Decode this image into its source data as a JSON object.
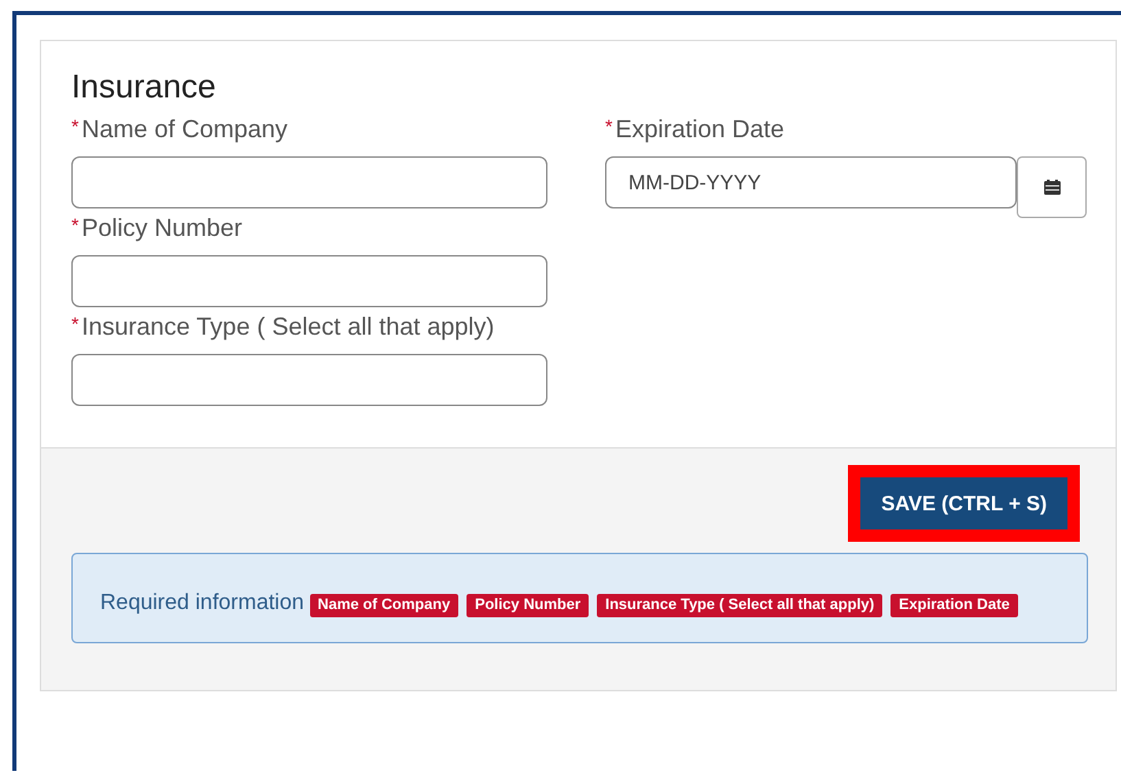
{
  "section": {
    "title": "Insurance"
  },
  "left_fields": [
    {
      "mark": "*",
      "label": "Name of Company"
    },
    {
      "mark": "*",
      "label": "Policy Number"
    },
    {
      "mark": "*",
      "label": "Insurance Type ( Select all that apply)"
    }
  ],
  "date_field": {
    "mark": "*",
    "label": "Expiration Date",
    "placeholder": "MM-DD-YYYY"
  },
  "save_button": {
    "label": "SAVE (CTRL + S)",
    "highlighted": true
  },
  "required_info": {
    "label": "Required information",
    "tags": [
      "Name of Company",
      "Policy Number",
      "Insurance Type ( Select all that apply)",
      "Expiration Date"
    ]
  }
}
